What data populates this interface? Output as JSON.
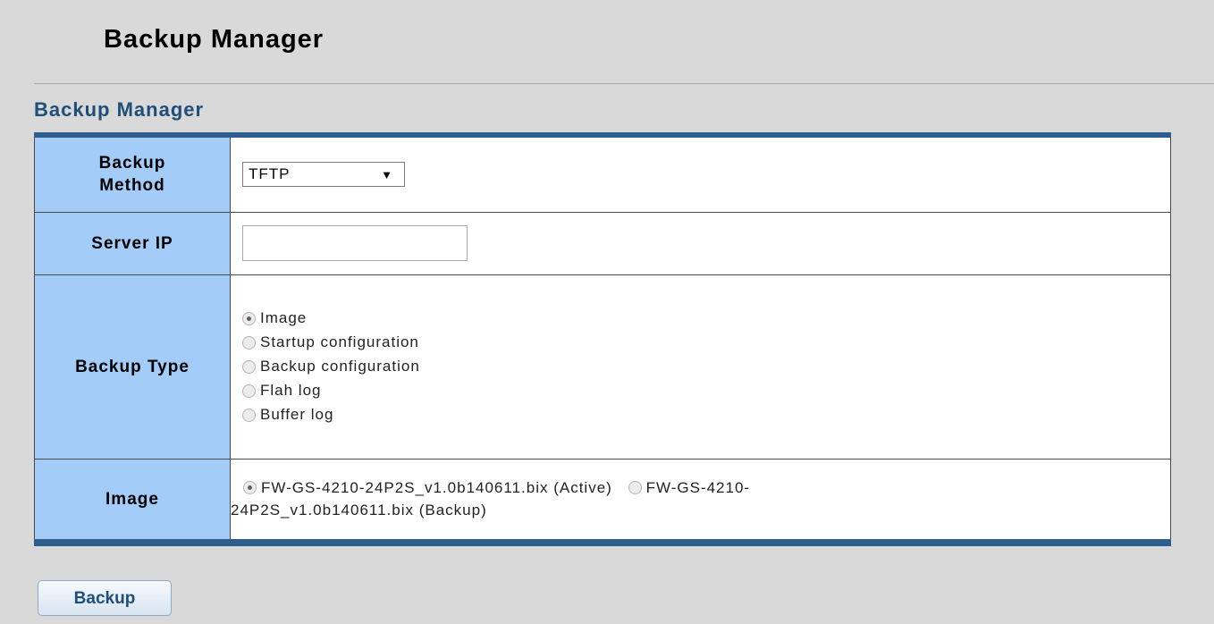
{
  "page": {
    "title": "Backup Manager"
  },
  "section": {
    "title": "Backup Manager"
  },
  "form": {
    "backup_method": {
      "label_line1": "Backup",
      "label_line2": "Method",
      "selected": "TFTP"
    },
    "server_ip": {
      "label": "Server IP",
      "value": ""
    },
    "backup_type": {
      "label": "Backup Type",
      "options": [
        {
          "label": "Image",
          "checked": true
        },
        {
          "label": "Startup configuration",
          "checked": false
        },
        {
          "label": "Backup configuration",
          "checked": false
        },
        {
          "label": "Flah log",
          "checked": false
        },
        {
          "label": "Buffer log",
          "checked": false
        }
      ]
    },
    "image": {
      "label": "Image",
      "options": [
        {
          "label": "FW-GS-4210-24P2S_v1.0b140611.bix (Active)",
          "checked": true
        },
        {
          "label": "FW-GS-4210-24P2S_v1.0b140611.bix (Backup)",
          "checked": false
        }
      ]
    }
  },
  "actions": {
    "backup_label": "Backup"
  },
  "colors": {
    "label_bg": "#a3cdf8",
    "section_title": "#1f4e79",
    "table_border": "#2e5e8e"
  }
}
